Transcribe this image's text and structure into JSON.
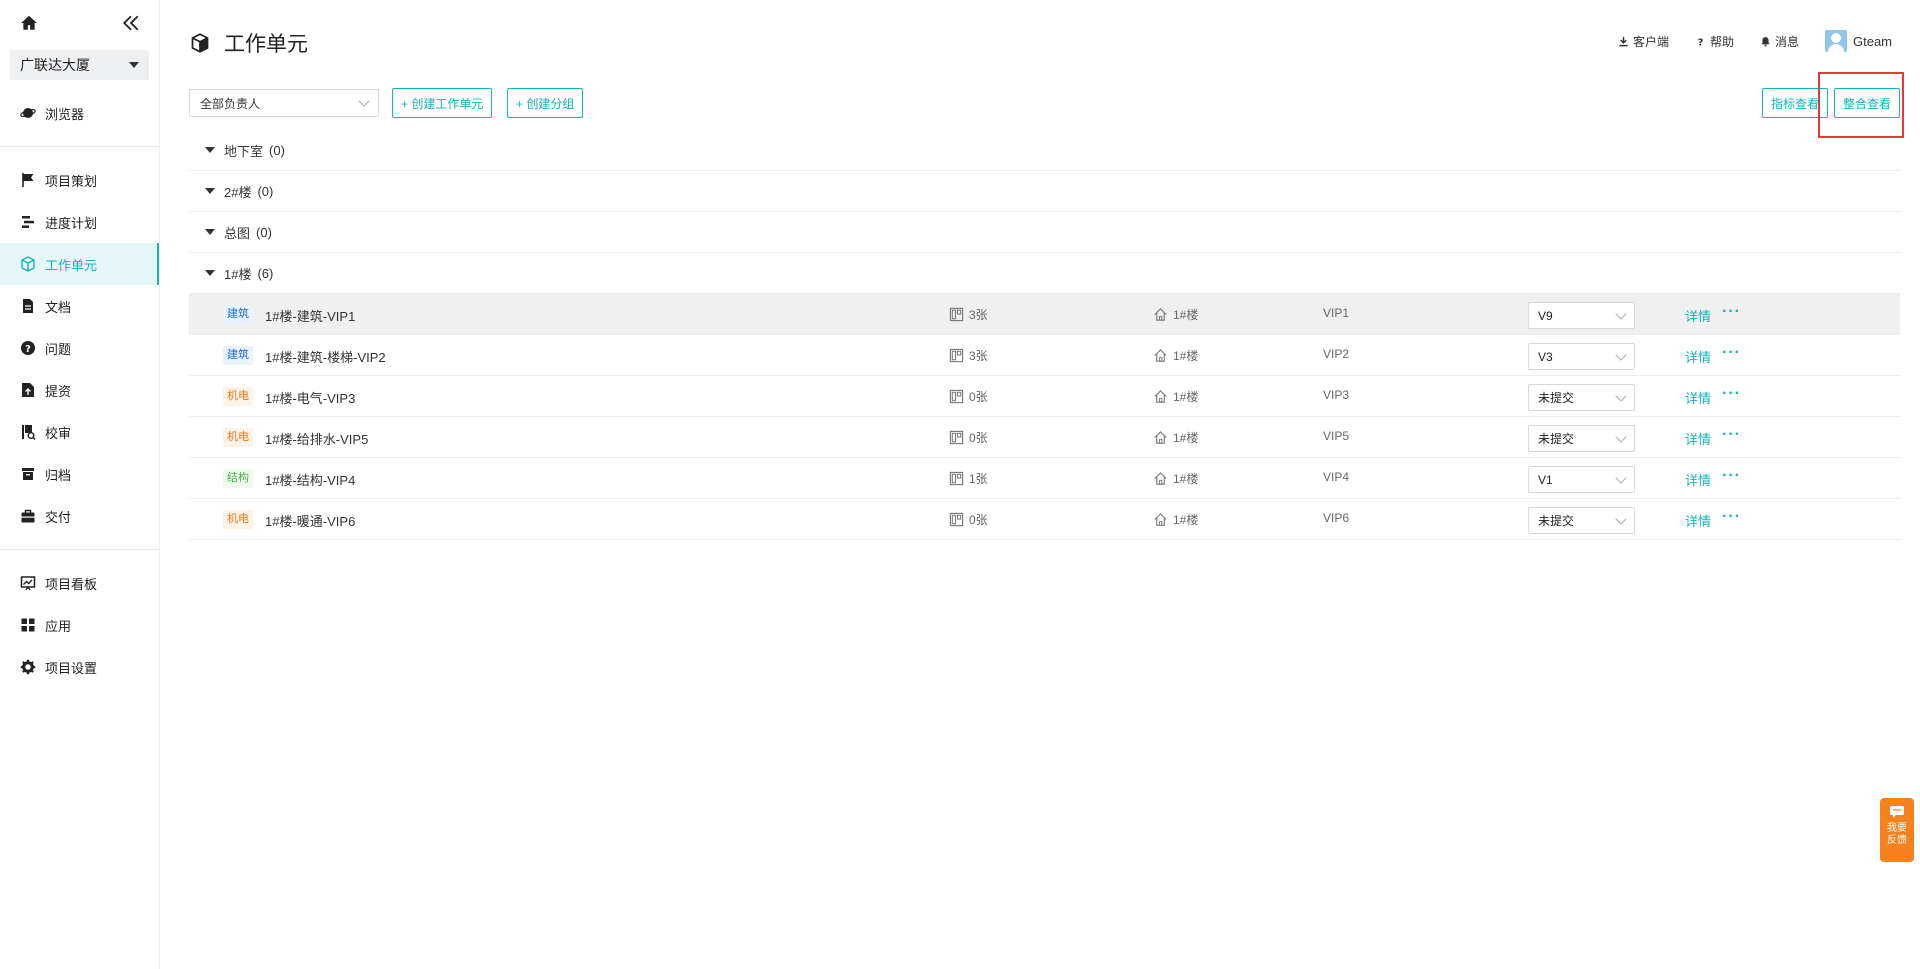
{
  "sidebar": {
    "project_name": "广联达大厦",
    "items": [
      {
        "label": "浏览器"
      },
      {
        "label": "项目策划"
      },
      {
        "label": "进度计划"
      },
      {
        "label": "工作单元"
      },
      {
        "label": "文档"
      },
      {
        "label": "问题"
      },
      {
        "label": "提资"
      },
      {
        "label": "校审"
      },
      {
        "label": "归档"
      },
      {
        "label": "交付"
      },
      {
        "label": "项目看板"
      },
      {
        "label": "应用"
      },
      {
        "label": "项目设置"
      }
    ]
  },
  "header": {
    "title": "工作单元",
    "client_label": "客户端",
    "help_label": "帮助",
    "message_label": "消息",
    "user_name": "Gteam"
  },
  "toolbar": {
    "owner_filter": "全部负责人",
    "create_unit_label": "+ 创建工作单元",
    "create_group_label": "+ 创建分组",
    "indicator_view_label": "指标查看",
    "integrate_view_label": "整合查看"
  },
  "groups": [
    {
      "name": "地下室",
      "count": "(0)"
    },
    {
      "name": "2#楼",
      "count": "(0)"
    },
    {
      "name": "总图",
      "count": "(0)"
    },
    {
      "name": "1#楼",
      "count": "(6)"
    }
  ],
  "units": [
    {
      "tag": "建筑",
      "name": "1#楼-建筑-VIP1",
      "sheets": "3张",
      "floor": "1#楼",
      "code": "VIP1",
      "version": "V9"
    },
    {
      "tag": "建筑",
      "name": "1#楼-建筑-楼梯-VIP2",
      "sheets": "3张",
      "floor": "1#楼",
      "code": "VIP2",
      "version": "V3"
    },
    {
      "tag": "机电",
      "name": "1#楼-电气-VIP3",
      "sheets": "0张",
      "floor": "1#楼",
      "code": "VIP3",
      "version": "未提交"
    },
    {
      "tag": "机电",
      "name": "1#楼-给排水-VIP5",
      "sheets": "0张",
      "floor": "1#楼",
      "code": "VIP5",
      "version": "未提交"
    },
    {
      "tag": "结构",
      "name": "1#楼-结构-VIP4",
      "sheets": "1张",
      "floor": "1#楼",
      "code": "VIP4",
      "version": "V1"
    },
    {
      "tag": "机电",
      "name": "1#楼-暖通-VIP6",
      "sheets": "0张",
      "floor": "1#楼",
      "code": "VIP6",
      "version": "未提交"
    }
  ],
  "row_actions": {
    "detail_label": "详情",
    "more_label": "···"
  },
  "feedback": {
    "line1": "我要",
    "line2": "反馈"
  },
  "colors": {
    "accent": "#16b3b8",
    "highlight": "#e53935",
    "feedback": "#f5821f"
  }
}
